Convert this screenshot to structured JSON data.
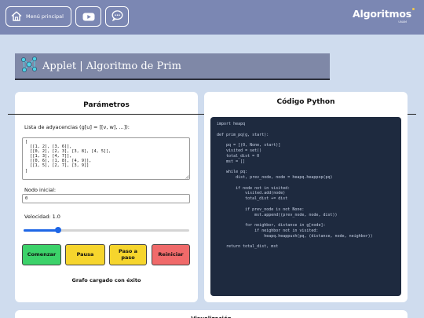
{
  "nav": {
    "home_label": "Menú principal",
    "logo_text": "Algoritmos",
    "logo_sub": "UNAM"
  },
  "header": {
    "title": "Applet | Algoritmo de Prim"
  },
  "params": {
    "heading": "Parámetros",
    "adjacency_label": "Lista de adyacencias (g[u] = [[v, w], ...]):",
    "adjacency_value": "[\n  [[1, 2], [3, 6]],\n  [[0, 2], [2, 3], [3, 8], [4, 5]],\n  [[1, 3], [4, 7]],\n  [[0, 6], [1, 8], [4, 9]],\n  [[1, 5], [2, 7], [3, 9]]\n]",
    "start_node_label": "Nodo inicial:",
    "start_node_value": "0",
    "speed_label": "Velocidad: 1.0",
    "speed_fraction": 0.21,
    "buttons": {
      "start": "Comenzar",
      "pause": "Pausa",
      "step": "Paso a paso",
      "reset": "Reiniciar"
    },
    "status": "Grafo cargado con éxito"
  },
  "code_panel": {
    "heading": "Código Python",
    "code": "import heapq\n\ndef prim_pq(g, start):\n\n    pq = [(0, None, start)]\n    visited = set()\n    total_dist = 0\n    mst = []\n\n    while pq:\n        dist, prev_node, node = heapq.heappop(pq)\n\n        if node not in visited:\n            visited.add(node)\n            total_dist += dist\n\n            if prev_node is not None:\n                mst.append((prev_node, node, dist))\n\n            for neighbor, distance in g[node]:\n                if neighbor not in visited:\n                    heapq.heappush(pq, (distance, node, neighbor))\n\n    return total_dist, mst"
  },
  "bottom": {
    "heading": "Visualización"
  },
  "colors": {
    "topbar": "#7b87b3",
    "background": "#cfdcee",
    "start": "#3cd26a",
    "pause": "#f6d52d",
    "reset": "#f06a6a",
    "slider": "#1e66e6",
    "code_bg": "#1e2a3f"
  }
}
